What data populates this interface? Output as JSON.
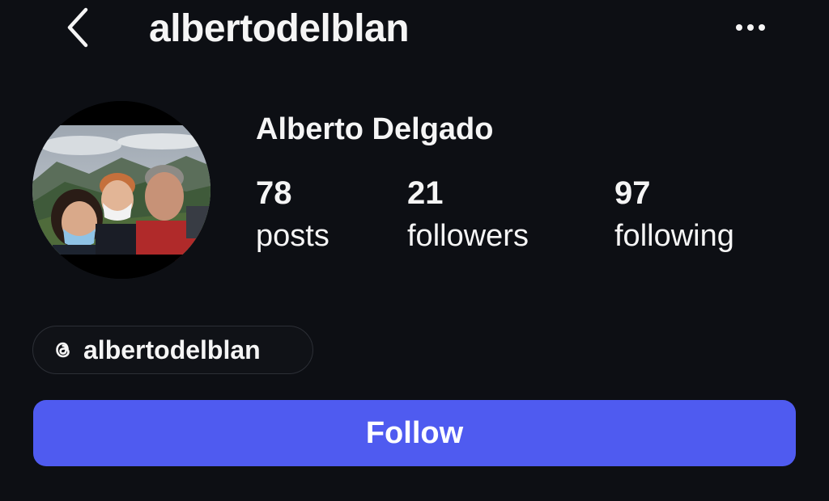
{
  "header": {
    "back_icon": "chevron-left-icon",
    "username": "albertodelblan",
    "more_icon": "more-horizontal-icon"
  },
  "profile": {
    "display_name": "Alberto Delgado",
    "avatar_description_icon": "profile-photo-avatar",
    "stats": {
      "posts": {
        "value": "78",
        "label": "posts"
      },
      "followers": {
        "value": "21",
        "label": "followers"
      },
      "following": {
        "value": "97",
        "label": "following"
      }
    }
  },
  "threads_link": {
    "icon": "threads-icon",
    "handle": "albertodelblan"
  },
  "actions": {
    "follow_label": "Follow"
  },
  "colors": {
    "background": "#0d0f14",
    "text": "#f5f5f5",
    "follow_button": "#4f5bf0",
    "chip_border": "#2c2f36"
  }
}
